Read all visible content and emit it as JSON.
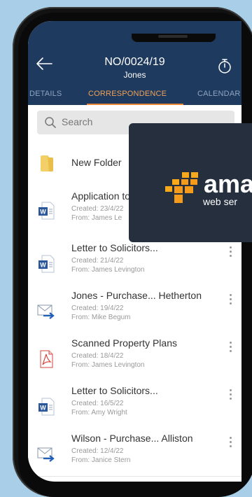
{
  "header": {
    "title": "NO/0024/19",
    "subtitle": "Jones"
  },
  "tabs": [
    {
      "label": "DETAILS",
      "active": false
    },
    {
      "label": "CORRESPONDENCE",
      "active": true
    },
    {
      "label": "CALENDAR",
      "active": false
    }
  ],
  "search": {
    "placeholder": "Search"
  },
  "items": [
    {
      "title": "New Folder",
      "type": "folder"
    },
    {
      "title": "Application to",
      "created": "Created: 23/4/22",
      "from": "From: James Le",
      "type": "word"
    },
    {
      "title": "Letter to Solicitors...",
      "created": "Created: 21/4/22",
      "from": "From: James Levington",
      "type": "word"
    },
    {
      "title": "Jones - Purchase... Hetherton",
      "created": "Created: 19/4/22",
      "from": "From: Mike Begum",
      "type": "email"
    },
    {
      "title": "Scanned Property Plans",
      "created": "Created: 18/4/22",
      "from": "From: James Levington",
      "type": "pdf"
    },
    {
      "title": "Letter to Solicitors...",
      "created": "Created: 16/5/22",
      "from": "From: Amy Wright",
      "type": "word"
    },
    {
      "title": "Wilson - Purchase... Alliston",
      "created": "Created: 12/4/22",
      "from": "From: Janice Stern",
      "type": "email"
    }
  ],
  "aws_overlay": {
    "logo_text": "ama",
    "logo_sub": "web ser"
  },
  "colors": {
    "header_bg": "#1f3a5f",
    "tab_active": "#f0a258",
    "tab_inactive": "#8fa4bf",
    "background": "#a9cfe8",
    "aws_bg": "#262f3e",
    "aws_orange": "#f59b1c"
  }
}
